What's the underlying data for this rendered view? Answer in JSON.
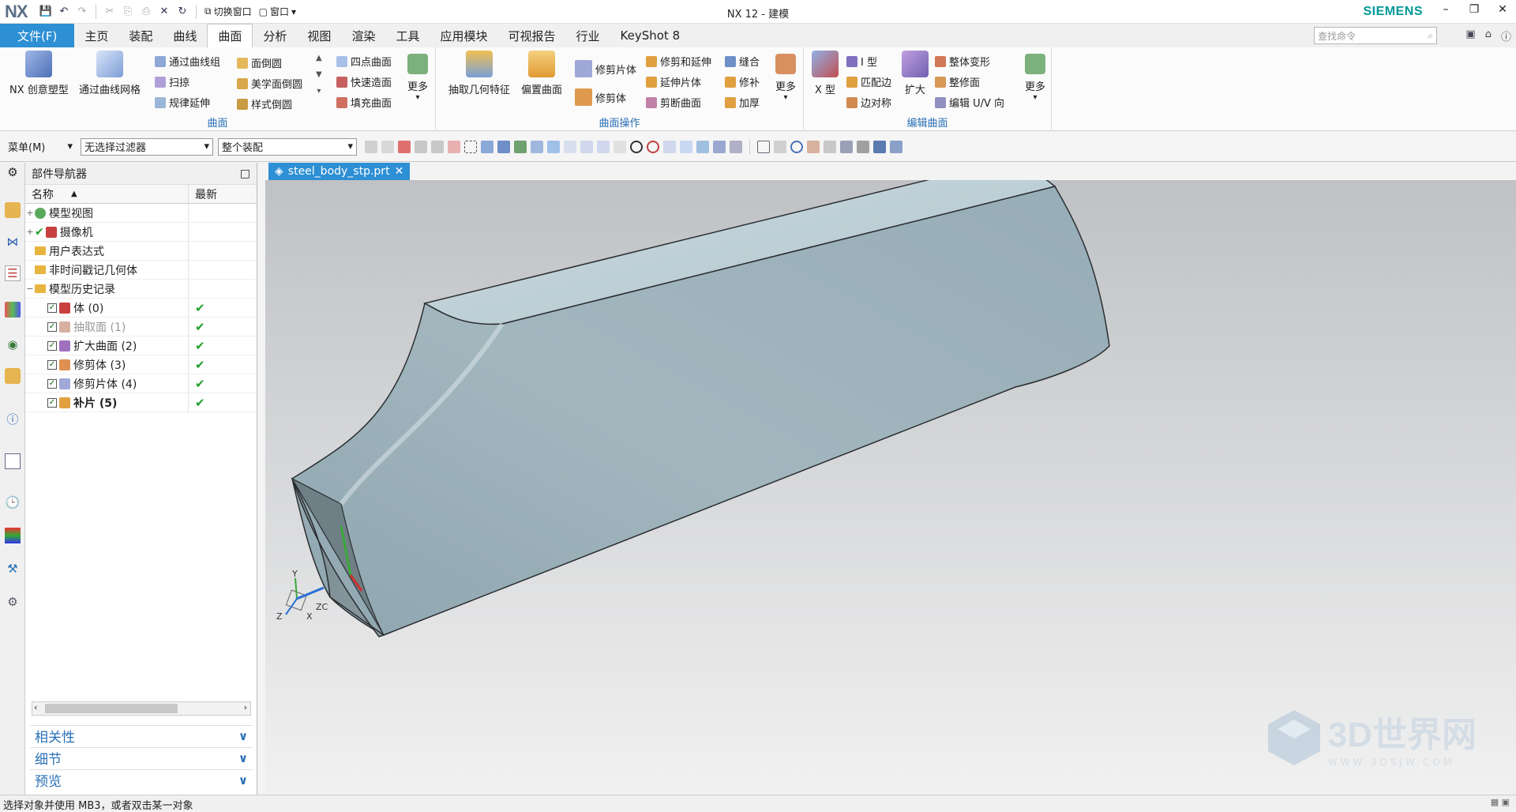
{
  "titlebar": {
    "logo": "NX",
    "title": "NX 12 - 建模",
    "brand": "SIEMENS",
    "switch_window": "切换窗口",
    "window": "窗口"
  },
  "menubar": {
    "tabs": [
      "文件(F)",
      "主页",
      "装配",
      "曲线",
      "曲面",
      "分析",
      "视图",
      "渲染",
      "工具",
      "应用模块",
      "可视报告",
      "行业",
      "KeyShot 8"
    ],
    "search_placeholder": "查找命令"
  },
  "ribbon": {
    "surface": {
      "label": "曲面",
      "nx_creative": "NX 创意塑型",
      "through_curve_mesh": "通过曲线网格",
      "through_curves": "通过曲线组",
      "sweep": "扫掠",
      "ruled_extend": "规律延伸",
      "face_blend": "面倒圆",
      "aesthetic_blend": "美学面倒圆",
      "style_blend": "样式倒圆",
      "four_point": "四点曲面",
      "quick_surface": "快速造面",
      "fill_surface": "填充曲面",
      "more": "更多"
    },
    "surface_ops": {
      "label": "曲面操作",
      "extract": "抽取几何特征",
      "offset": "偏置曲面",
      "trim_sheet": "修剪片体",
      "trim_body": "修剪体",
      "trim_extend": "修剪和延伸",
      "extend_sheet": "延伸片体",
      "divide_face": "剪断曲面",
      "sew": "缝合",
      "patch": "修补",
      "thicken": "加厚",
      "more": "更多"
    },
    "edit_surface": {
      "label": "编辑曲面",
      "x_form": "X 型",
      "i_form": "I 型",
      "match_edge": "匹配边",
      "edge_sym": "边对称",
      "enlarge": "扩大",
      "global_shaping": "整体变形",
      "refit": "整修面",
      "edit_uv": "编辑 U/V 向",
      "more": "更多"
    }
  },
  "toolbar2": {
    "menu": "菜单(M)",
    "filter": "无选择过滤器",
    "scope": "整个装配"
  },
  "navigator": {
    "title": "部件导航器",
    "col_name": "名称",
    "col_latest": "最新",
    "rows": [
      {
        "label": "模型视图"
      },
      {
        "label": "摄像机"
      },
      {
        "label": "用户表达式"
      },
      {
        "label": "非时间戳记几何体"
      },
      {
        "label": "模型历史记录"
      },
      {
        "label": "体 (0)",
        "latest": "✔"
      },
      {
        "label": "抽取面 (1)",
        "latest": "✔"
      },
      {
        "label": "扩大曲面 (2)",
        "latest": "✔"
      },
      {
        "label": "修剪体 (3)",
        "latest": "✔"
      },
      {
        "label": "修剪片体 (4)",
        "latest": "✔"
      },
      {
        "label": "补片 (5)",
        "latest": "✔"
      }
    ],
    "panels": [
      "相关性",
      "细节",
      "预览"
    ]
  },
  "document_tab": "steel_body_stp.prt",
  "viewport": {
    "axis_x": "X",
    "axis_y": "Y",
    "axis_z": "Z",
    "axis_zc": "ZC"
  },
  "watermark": {
    "title": "3D世界网",
    "url": "WWW.3DSJW.COM"
  },
  "status": "选择对象并使用 MB3，或者双击某一对象",
  "colors": {
    "accent": "#2d8fd4",
    "label_blue": "#2a6fb5",
    "model": "#9fb5bf",
    "siemens": "#009999"
  }
}
